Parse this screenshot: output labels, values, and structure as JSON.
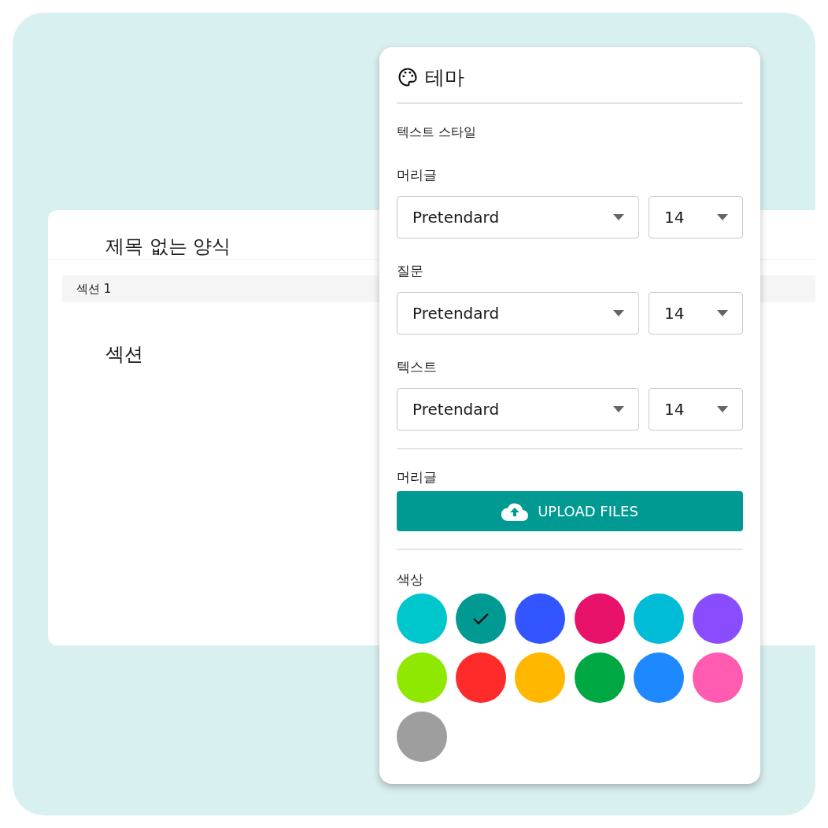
{
  "form": {
    "title": "제목 없는 양식",
    "section_tab": "섹션 1",
    "section_heading": "섹션"
  },
  "theme_panel": {
    "title": "테마",
    "subtitle": "텍스트 스타일",
    "font_rows": [
      {
        "label": "머리글",
        "font": "Pretendard",
        "size": "14"
      },
      {
        "label": "질문",
        "font": "Pretendard",
        "size": "14"
      },
      {
        "label": "텍스트",
        "font": "Pretendard",
        "size": "14"
      }
    ],
    "header_image": {
      "label": "머리글",
      "button": "UPLOAD FILES"
    },
    "colors": {
      "label": "색상",
      "swatches": [
        {
          "color": "#00c7cc",
          "selected": false
        },
        {
          "color": "#009a92",
          "selected": true
        },
        {
          "color": "#3355ff",
          "selected": false
        },
        {
          "color": "#e8126b",
          "selected": false
        },
        {
          "color": "#00bcd6",
          "selected": false
        },
        {
          "color": "#8a4cff",
          "selected": false
        },
        {
          "color": "#8fe800",
          "selected": false
        },
        {
          "color": "#ff2a2a",
          "selected": false
        },
        {
          "color": "#ffb700",
          "selected": false
        },
        {
          "color": "#00a843",
          "selected": false
        },
        {
          "color": "#1e88ff",
          "selected": false
        },
        {
          "color": "#ff5bb0",
          "selected": false
        },
        {
          "color": "#9e9e9e",
          "selected": false
        }
      ]
    }
  }
}
